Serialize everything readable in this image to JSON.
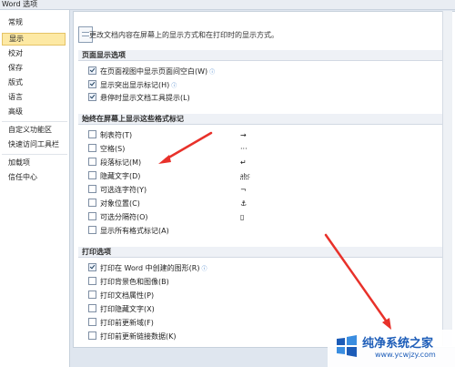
{
  "window": {
    "title": "Word 选项"
  },
  "sidebar": {
    "items": [
      {
        "label": "常规"
      },
      {
        "label": "显示"
      },
      {
        "label": "校对"
      },
      {
        "label": "保存"
      },
      {
        "label": "版式"
      },
      {
        "label": "语言"
      },
      {
        "label": "高级"
      },
      {
        "label": "自定义功能区"
      },
      {
        "label": "快速访问工具栏"
      },
      {
        "label": "加载项"
      },
      {
        "label": "信任中心"
      }
    ],
    "active": "显示"
  },
  "header": {
    "description": "更改文档内容在屏幕上的显示方式和在打印时的显示方式。"
  },
  "page_display": {
    "title": "页面显示选项",
    "options": [
      {
        "label": "在页面视图中显示页面间空白(W)",
        "checked": true,
        "info": "ⓘ"
      },
      {
        "label": "显示突出显示标记(H)",
        "checked": true,
        "info": "ⓘ"
      },
      {
        "label": "悬停时显示文档工具提示(L)",
        "checked": true
      }
    ]
  },
  "formatting_marks": {
    "title": "始终在屏幕上显示这些格式标记",
    "options": [
      {
        "label": "制表符(T)",
        "checked": false,
        "symbol": "→"
      },
      {
        "label": "空格(S)",
        "checked": false,
        "symbol": "···"
      },
      {
        "label": "段落标记(M)",
        "checked": false,
        "symbol": "↵"
      },
      {
        "label": "隐藏文字(D)",
        "checked": false,
        "symbol": "abc"
      },
      {
        "label": "可选连字符(Y)",
        "checked": false,
        "symbol": "¬"
      },
      {
        "label": "对象位置(C)",
        "checked": false,
        "symbol": "⚓"
      },
      {
        "label": "可选分隔符(O)",
        "checked": false,
        "symbol": "▯"
      },
      {
        "label": "显示所有格式标记(A)",
        "checked": false
      }
    ]
  },
  "print_options": {
    "title": "打印选项",
    "options": [
      {
        "label": "打印在 Word 中创建的图形(R)",
        "checked": true,
        "info": "ⓘ"
      },
      {
        "label": "打印背景色和图像(B)",
        "checked": false
      },
      {
        "label": "打印文档属性(P)",
        "checked": false
      },
      {
        "label": "打印隐藏文字(X)",
        "checked": false
      },
      {
        "label": "打印前更新域(F)",
        "checked": false
      },
      {
        "label": "打印前更新链接数据(K)",
        "checked": false
      }
    ]
  },
  "watermark": {
    "main": "纯净系统之家",
    "sub": "www.ycwjzy.com"
  },
  "colors": {
    "annotation_arrow": "#e8312a",
    "active_item": "#fde9a4",
    "brand": "#1c5cb8"
  }
}
